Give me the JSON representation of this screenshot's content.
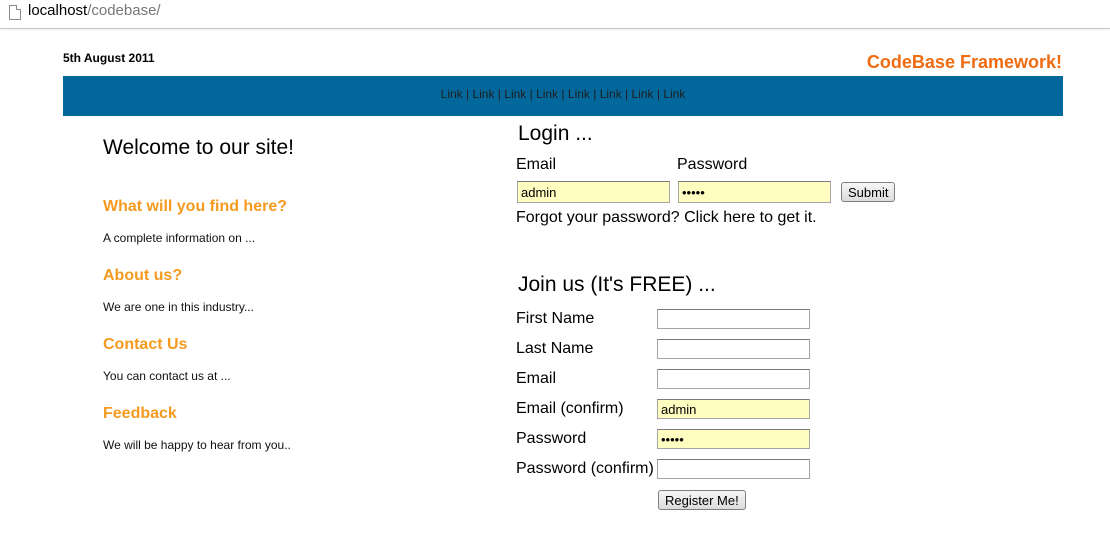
{
  "browser": {
    "url_host": "localhost",
    "url_path": "/codebase/",
    "page_icon": "page-icon"
  },
  "header": {
    "date": "5th August 2011",
    "brand": "CodeBase Framework!",
    "nav_links": [
      "Link",
      "Link",
      "Link",
      "Link",
      "Link",
      "Link",
      "Link",
      "Link"
    ],
    "nav_separator": " | "
  },
  "left": {
    "welcome": "Welcome to our site!",
    "sections": [
      {
        "title": "What will you find here?",
        "text": "A complete information on ..."
      },
      {
        "title": "About us?",
        "text": "We are one in this industry..."
      },
      {
        "title": "Contact Us",
        "text": "You can contact us at ..."
      },
      {
        "title": "Feedback",
        "text": "We will be happy to hear from you.."
      }
    ]
  },
  "login": {
    "title": "Login ...",
    "email_label": "Email",
    "password_label": "Password",
    "email_value": "admin",
    "password_value": "•••••",
    "submit_label": "Submit",
    "forgot_text": "Forgot your password? Click here to get it."
  },
  "register": {
    "title": "Join us (It's FREE) ...",
    "fields": [
      {
        "label": "First Name",
        "value": ""
      },
      {
        "label": "Last Name",
        "value": ""
      },
      {
        "label": "Email",
        "value": ""
      },
      {
        "label": "Email (confirm)",
        "value": "admin"
      },
      {
        "label": "Password",
        "value": "•••••"
      },
      {
        "label": "Password (confirm)",
        "value": ""
      }
    ],
    "button_label": "Register Me!"
  },
  "colors": {
    "brand": "#ef6c12",
    "nav_bg": "#02689c",
    "section_title": "#f39a1f",
    "autofill": "#fffdc0"
  }
}
